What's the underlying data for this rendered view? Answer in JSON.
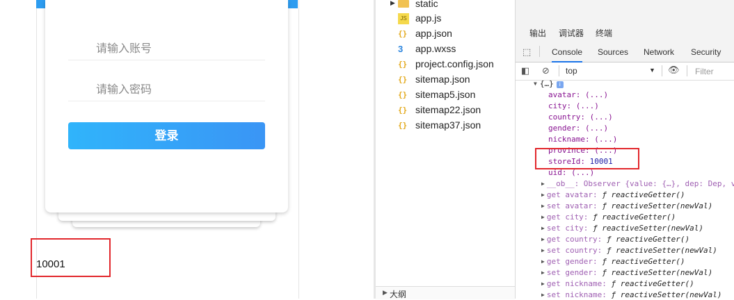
{
  "preview": {
    "account_placeholder": "请输入账号",
    "password_placeholder": "请输入密码",
    "login_label": "登录",
    "store_id_value": "10001"
  },
  "file_tree": {
    "items": [
      {
        "name": "static",
        "icon": "folder-icon"
      },
      {
        "name": "app.js",
        "icon": "js-file-icon"
      },
      {
        "name": "app.json",
        "icon": "json-file-icon"
      },
      {
        "name": "app.wxss",
        "icon": "css-file-icon"
      },
      {
        "name": "project.config.json",
        "icon": "json-file-icon"
      },
      {
        "name": "sitemap.json",
        "icon": "json-file-icon"
      },
      {
        "name": "sitemap5.json",
        "icon": "json-file-icon"
      },
      {
        "name": "sitemap22.json",
        "icon": "json-file-icon"
      },
      {
        "name": "sitemap37.json",
        "icon": "json-file-icon"
      }
    ],
    "outline_label": "大纲"
  },
  "devtools": {
    "top_tabs": [
      "输出",
      "调试器",
      "终端"
    ],
    "panel_tabs": [
      "Console",
      "Sources",
      "Network",
      "Security"
    ],
    "context": "top",
    "filter_placeholder": "Filter",
    "console_lines": {
      "object_header": "{…}",
      "info_badge": "i",
      "avatar": "avatar: (...)",
      "city": "city: (...)",
      "country": "country: (...)",
      "gender": "gender: (...)",
      "nickname": "nickname: (...)",
      "province": "province: (...)",
      "storeId_key": "storeId:",
      "storeId_val": "10001",
      "uid": "uid: (...)",
      "ob": "__ob__: Observer {value: {…}, dep: Dep, v",
      "get_avatar": "get avatar:",
      "set_avatar": "set avatar:",
      "get_city": "get city:",
      "set_city": "set city:",
      "get_country": "get country:",
      "set_country": "set country:",
      "get_gender": "get gender:",
      "set_gender": "set gender:",
      "get_nickname": "get nickname:",
      "set_nickname": "set nickname:",
      "getter": "ƒ reactiveGetter()",
      "setter": "ƒ reactiveSetter(newVal)"
    }
  },
  "colors": {
    "highlight_box": "#e2262b",
    "login_button": "#3aa5f8"
  }
}
